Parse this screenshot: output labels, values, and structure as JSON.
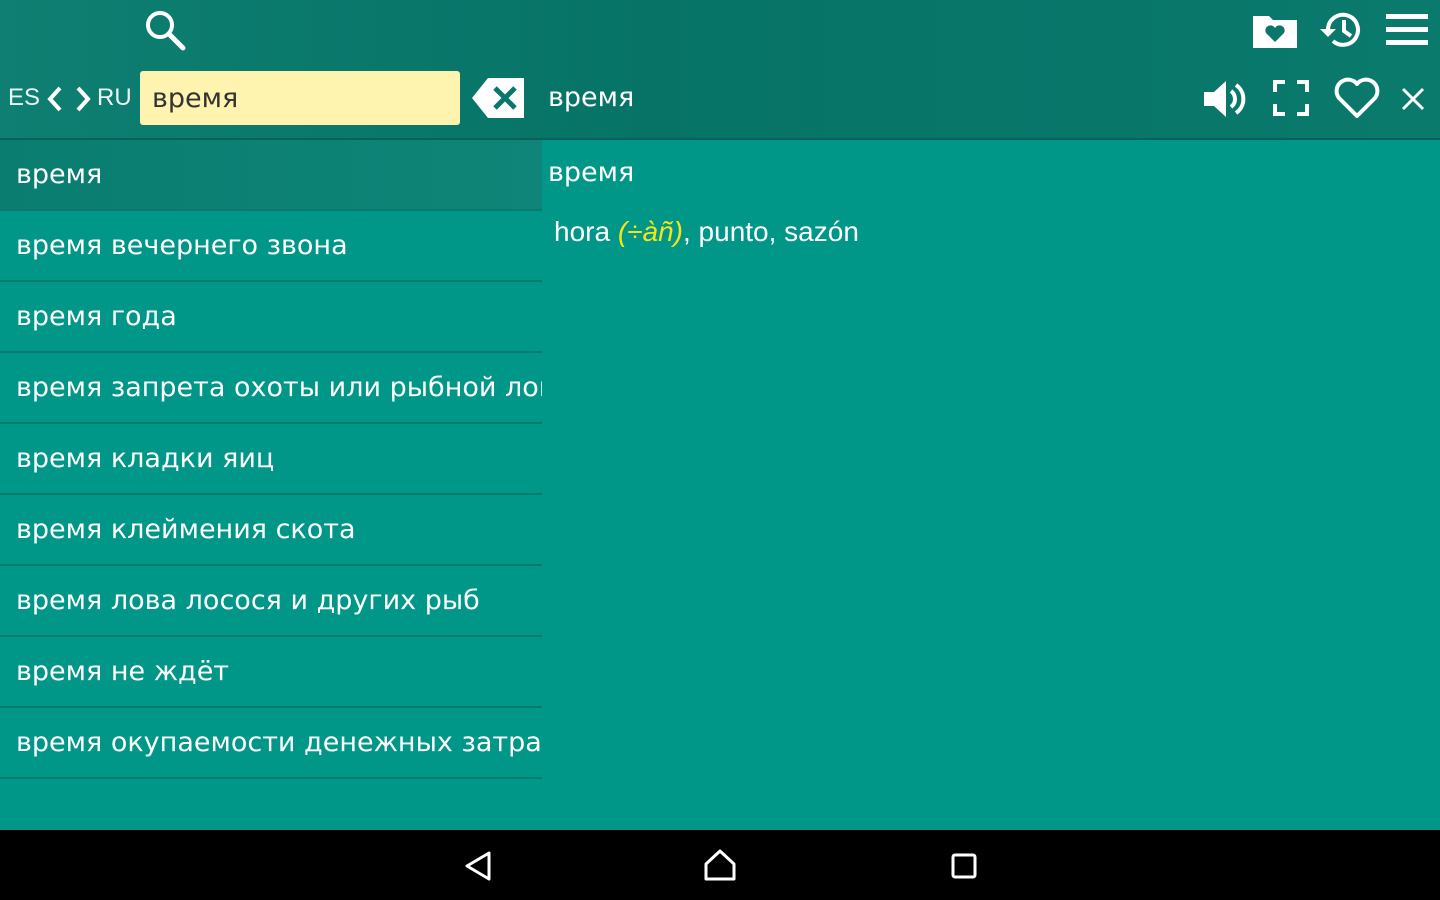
{
  "toolbar": {
    "icons": [
      "search-icon",
      "favorites-folder-icon",
      "history-icon",
      "menu-icon"
    ]
  },
  "search": {
    "lang_from": "ES",
    "lang_to": "RU",
    "query": "время"
  },
  "header": {
    "word": "время",
    "icons": [
      "speaker-icon",
      "fullscreen-icon",
      "heart-icon",
      "close-icon"
    ]
  },
  "results": [
    "время",
    "время вечернего звона",
    "время года",
    "время запрета охоты или рыбной ловли",
    "время кладки яиц",
    "время клеймения скота",
    "время лова лосося и других рыб",
    "время не ждёт",
    "время окупаемости денежных затрат"
  ],
  "selected_index": 0,
  "detail": {
    "headword": "время",
    "translation_first": "hora",
    "grammar": "(÷àñ)",
    "translation_rest": ", punto, sazón"
  },
  "navbar": {
    "icons": [
      "back-icon",
      "home-icon",
      "recents-icon"
    ]
  },
  "colors": {
    "toolbar": "#067366",
    "content": "#009688",
    "search_bg": "#fff3b0",
    "grammar": "#f3e51c",
    "navbar": "#000000"
  }
}
